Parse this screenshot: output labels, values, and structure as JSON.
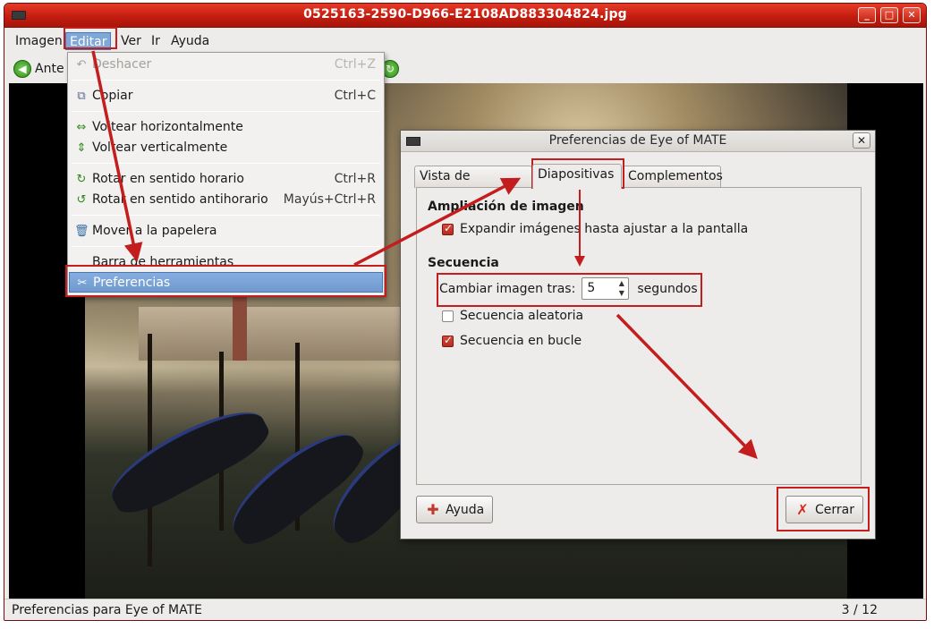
{
  "window": {
    "title": "0525163-2590-D966-E2108AD883304824.jpg"
  },
  "menubar": {
    "items": [
      "Imagen",
      "Editar",
      "Ver",
      "Ir",
      "Ayuda"
    ],
    "active": "Editar"
  },
  "toolbar": {
    "back_label": "Ante"
  },
  "edit_menu": {
    "items": [
      {
        "label": "Deshacer",
        "accel": "Ctrl+Z",
        "icon": "undo-icon",
        "disabled": true
      },
      {
        "label": "Copiar",
        "accel": "Ctrl+C",
        "icon": "copy-icon"
      },
      {
        "label": "Voltear horizontalmente",
        "accel": "",
        "icon": "flip-horizontal-icon"
      },
      {
        "label": "Voltear verticalmente",
        "accel": "",
        "icon": "flip-vertical-icon"
      },
      {
        "label": "Rotar en sentido horario",
        "accel": "Ctrl+R",
        "icon": "rotate-cw-icon"
      },
      {
        "label": "Rotar en sentido antihorario",
        "accel": "Mayús+Ctrl+R",
        "icon": "rotate-ccw-icon"
      },
      {
        "label": "Mover a la papelera",
        "accel": "",
        "icon": "trash-icon"
      },
      {
        "label": "Barra de herramientas",
        "accel": ""
      },
      {
        "label": "Preferencias",
        "accel": "",
        "icon": "preferences-icon",
        "highlighted": true
      }
    ]
  },
  "preferences_dialog": {
    "title": "Preferencias de Eye of MATE",
    "close_glyph": "✕",
    "tabs": [
      "Vista de imágenes",
      "Diapositivas",
      "Complementos"
    ],
    "selected_tab": "Diapositivas",
    "zoom_section": {
      "heading": "Ampliación de imagen",
      "expand_label": "Expandir imágenes hasta ajustar a la pantalla",
      "expand_checked": true
    },
    "sequence_section": {
      "heading": "Secuencia",
      "change_label": "Cambiar imagen tras:",
      "change_value": "5",
      "change_unit": "segundos",
      "random_label": "Secuencia aleatoria",
      "random_checked": false,
      "loop_label": "Secuencia en bucle",
      "loop_checked": true
    },
    "help_button": "Ayuda",
    "close_button": "Cerrar"
  },
  "statusbar": {
    "message": "Preferencias para Eye of MATE",
    "counter": "3 / 12"
  },
  "colors": {
    "titlebar": "#c41d10",
    "highlight": "#6f98cf",
    "annotation": "#c41d1d",
    "checkbox_on": "#b82b1f"
  }
}
